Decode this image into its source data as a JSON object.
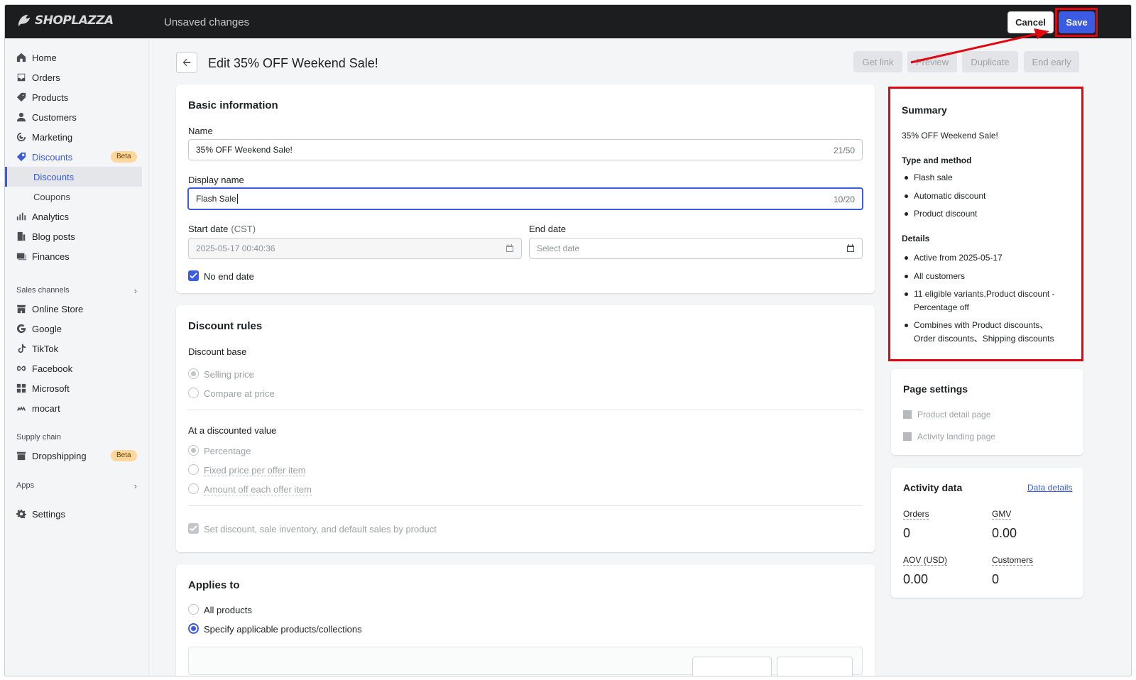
{
  "topbar": {
    "logo_text": "SHOPLAZZA",
    "status": "Unsaved changes",
    "cancel_label": "Cancel",
    "save_label": "Save"
  },
  "sidebar": {
    "items": [
      {
        "label": "Home",
        "icon": "home-icon"
      },
      {
        "label": "Orders",
        "icon": "orders-icon"
      },
      {
        "label": "Products",
        "icon": "tag-icon"
      },
      {
        "label": "Customers",
        "icon": "person-icon"
      },
      {
        "label": "Marketing",
        "icon": "target-icon"
      },
      {
        "label": "Discounts",
        "icon": "discount-icon",
        "badge": "Beta"
      },
      {
        "label": "Discounts",
        "sub": true,
        "active": true
      },
      {
        "label": "Coupons",
        "sub": true
      },
      {
        "label": "Analytics",
        "icon": "bar-chart-icon"
      },
      {
        "label": "Blog posts",
        "icon": "blog-icon"
      },
      {
        "label": "Finances",
        "icon": "finance-icon"
      }
    ],
    "sales_channels_label": "Sales channels",
    "channels": [
      {
        "label": "Online Store",
        "icon": "store-icon"
      },
      {
        "label": "Google",
        "icon": "google-icon"
      },
      {
        "label": "TikTok",
        "icon": "tiktok-icon"
      },
      {
        "label": "Facebook",
        "icon": "meta-icon"
      },
      {
        "label": "Microsoft",
        "icon": "microsoft-icon"
      },
      {
        "label": "mocart",
        "icon": "mocart-icon"
      }
    ],
    "supply_chain_label": "Supply chain",
    "dropshipping": {
      "label": "Dropshipping",
      "badge": "Beta"
    },
    "apps_label": "Apps",
    "settings_label": "Settings"
  },
  "header": {
    "title": "Edit 35% OFF Weekend Sale!",
    "actions": [
      "Get link",
      "Preview",
      "Duplicate",
      "End early"
    ]
  },
  "basic_info": {
    "title": "Basic information",
    "name_label": "Name",
    "name_value": "35% OFF Weekend Sale!",
    "name_counter": "21/50",
    "display_label": "Display name",
    "display_value": "Flash Sale",
    "display_counter": "10/20",
    "start_label": "Start date",
    "start_tz": "(CST)",
    "start_value": "2025-05-17 00:40:36",
    "end_label": "End date",
    "end_placeholder": "Select date",
    "no_end_label": "No end date"
  },
  "discount_rules": {
    "title": "Discount rules",
    "base_label": "Discount base",
    "base_options": [
      "Selling price",
      "Compare at price"
    ],
    "value_label": "At a discounted value",
    "value_options": [
      "Percentage",
      "Fixed price per offer item",
      "Amount off each offer item"
    ],
    "set_by_product_label": "Set discount, sale inventory, and default sales by product"
  },
  "applies_to": {
    "title": "Applies to",
    "options": [
      "All products",
      "Specify applicable products/collections"
    ]
  },
  "summary": {
    "title": "Summary",
    "name": "35% OFF Weekend Sale!",
    "type_heading": "Type and method",
    "type_items": [
      "Flash sale",
      "Automatic discount",
      "Product discount"
    ],
    "details_heading": "Details",
    "detail_items": [
      "Active from 2025-05-17",
      "All customers",
      "11 eligible variants,Product discount - Percentage off",
      "Combines with Product discounts、Order discounts、Shipping discounts"
    ]
  },
  "page_settings": {
    "title": "Page settings",
    "items": [
      "Product detail page",
      "Activity landing page"
    ]
  },
  "activity": {
    "title": "Activity data",
    "link": "Data details",
    "orders_label": "Orders",
    "orders_value": "0",
    "gmv_label": "GMV",
    "gmv_value": "0.00",
    "aov_label": "AOV (USD)",
    "aov_value": "0.00",
    "customers_label": "Customers",
    "customers_value": "0"
  },
  "colors": {
    "accent": "#3b5be3",
    "highlight": "#e1060f",
    "topbar": "#1c1d1e"
  }
}
